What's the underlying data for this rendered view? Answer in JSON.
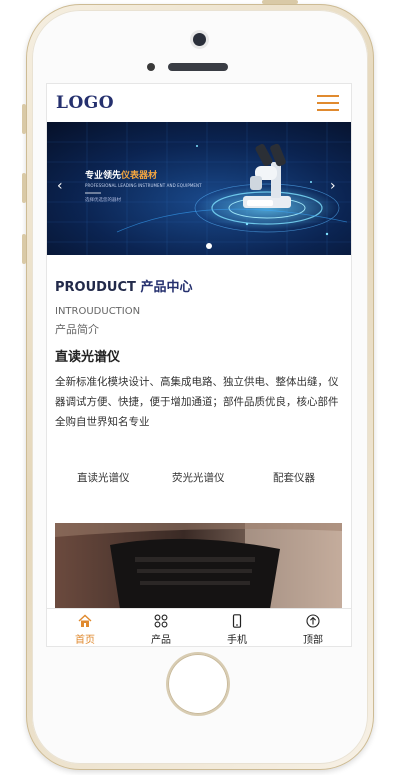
{
  "header": {
    "logo": "LOGO"
  },
  "banner": {
    "title_main": "专业领先",
    "title_accent": "仪表器材",
    "subtitle": "PROFESSIONAL LEADING INSTRUMENT AND EQUIPMENT",
    "tag": "选择优选您的器材",
    "prev_arrow": "‹",
    "next_arrow": "›"
  },
  "section": {
    "title_en": "PROUDUCT",
    "title_cn": "产品中心",
    "intro_en": "INTROUDUCTION",
    "intro_cn": "产品简介",
    "product_name": "直读光谱仪",
    "description": "全新标准化模块设计、高集成电路、独立供电、整体出缝，仪器调试方便、快捷，便于增加通道；部件品质优良，核心部件全购自世界知名专业"
  },
  "categories": [
    {
      "label": "直读光谱仪"
    },
    {
      "label": "荧光光谱仪"
    },
    {
      "label": "配套仪器"
    }
  ],
  "tabbar": {
    "items": [
      {
        "label": "首页",
        "icon": "home-icon",
        "active": true
      },
      {
        "label": "产品",
        "icon": "grid-icon"
      },
      {
        "label": "手机",
        "icon": "phone-icon"
      },
      {
        "label": "顶部",
        "icon": "arrow-up-icon"
      }
    ]
  },
  "colors": {
    "accent": "#e08a2f",
    "logo": "#25306e",
    "banner_bg": "#0b1a3a"
  }
}
